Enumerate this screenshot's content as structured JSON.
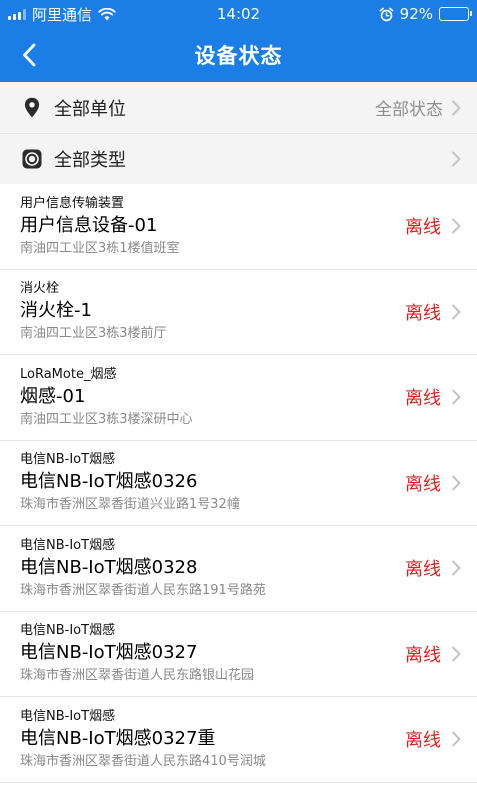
{
  "status_bar": {
    "carrier": "阿里通信",
    "time": "14:02",
    "battery": "92%",
    "battery_level": 0.92
  },
  "nav": {
    "title": "设备状态"
  },
  "filters": {
    "unit_label": "全部单位",
    "state_value": "全部状态",
    "type_label": "全部类型"
  },
  "colors": {
    "primary": "#1a7ee6",
    "offline": "#e02020"
  },
  "devices": [
    {
      "type": "用户信息传输装置",
      "name": "用户信息设备-01",
      "location": "南油四工业区3栋1楼值班室",
      "status": "离线"
    },
    {
      "type": "消火栓",
      "name": "消火栓-1",
      "location": "南油四工业区3栋3楼前厅",
      "status": "离线"
    },
    {
      "type": "LoRaMote_烟感",
      "name": "烟感-01",
      "location": "南油四工业区3栋3楼深研中心",
      "status": "离线"
    },
    {
      "type": "电信NB-IoT烟感",
      "name": "电信NB-IoT烟感0326",
      "location": "珠海市香洲区翠香街道兴业路1号32幢",
      "status": "离线"
    },
    {
      "type": "电信NB-IoT烟感",
      "name": "电信NB-IoT烟感0328",
      "location": "珠海市香洲区翠香街道人民东路191号路苑",
      "status": "离线"
    },
    {
      "type": "电信NB-IoT烟感",
      "name": "电信NB-IoT烟感0327",
      "location": "珠海市香洲区翠香街道人民东路银山花园",
      "status": "离线"
    },
    {
      "type": "电信NB-IoT烟感",
      "name": "电信NB-IoT烟感0327重",
      "location": "珠海市香洲区翠香街道人民东路410号润城",
      "status": "离线"
    }
  ]
}
